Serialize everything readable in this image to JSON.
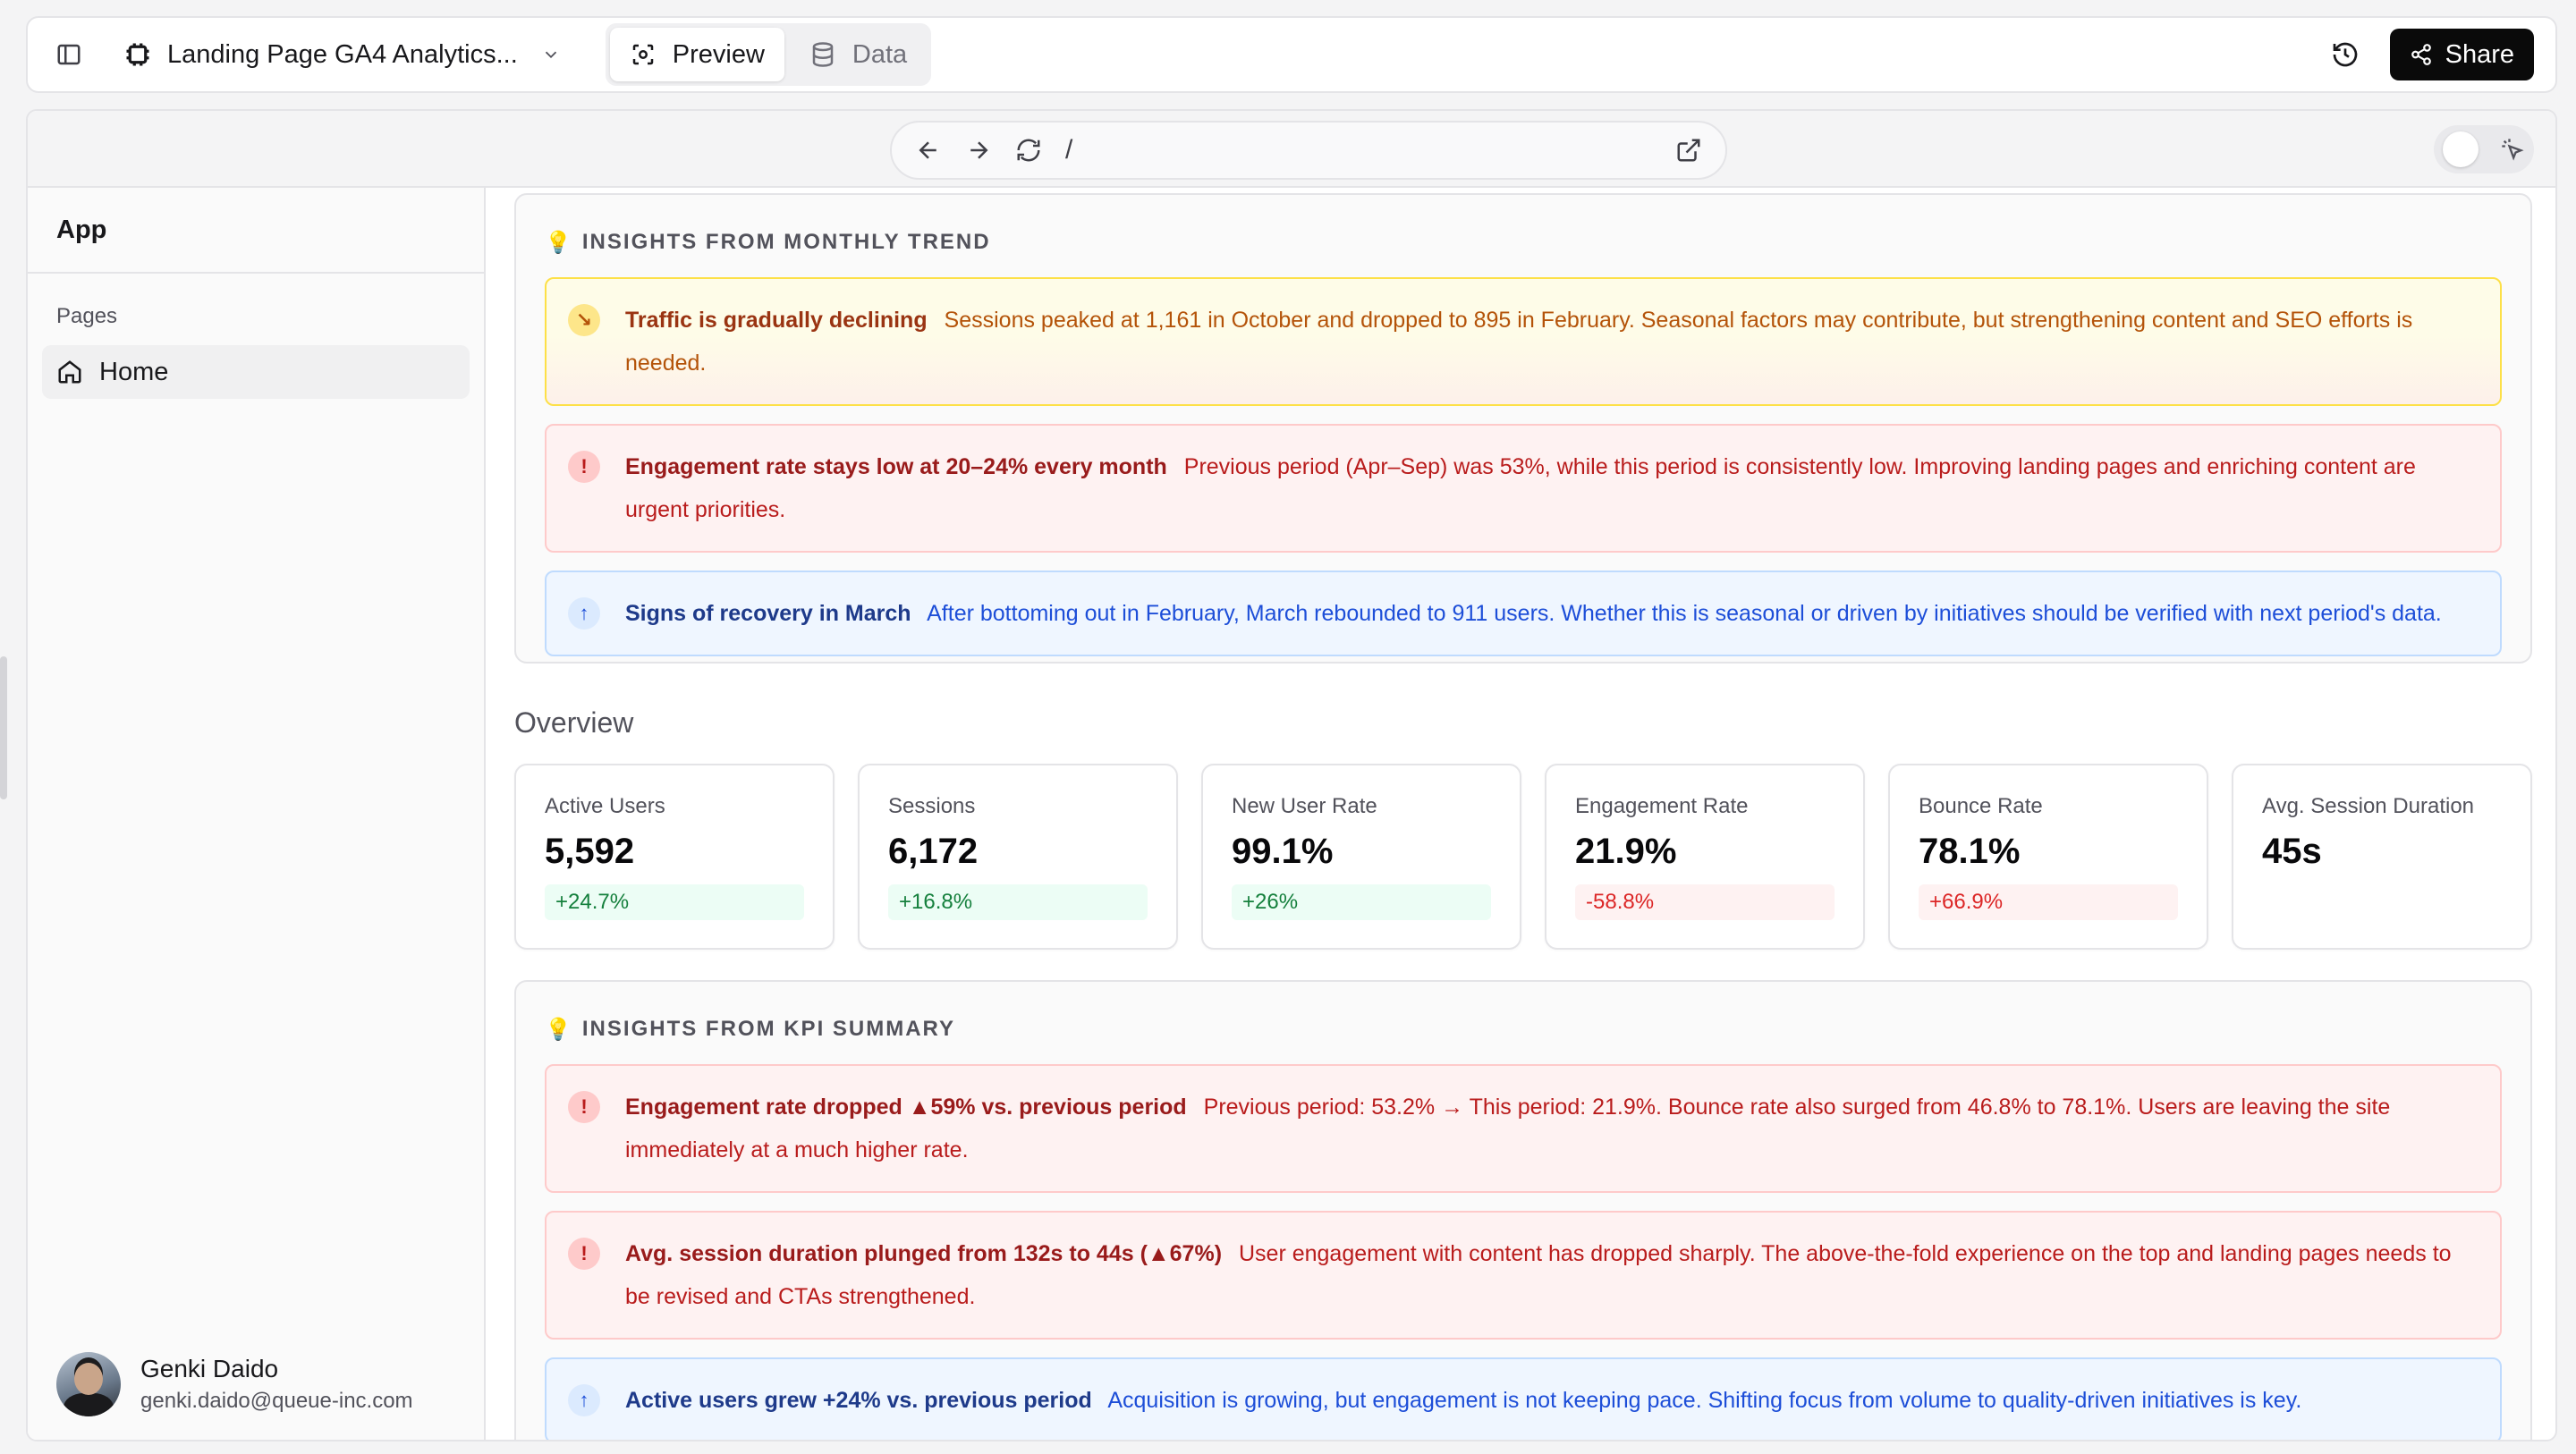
{
  "topbar": {
    "project_name": "Landing Page GA4 Analytics...",
    "tabs": [
      {
        "label": "Preview",
        "active": true
      },
      {
        "label": "Data",
        "active": false
      }
    ],
    "share_label": "Share"
  },
  "browser": {
    "path": "/"
  },
  "sidebar": {
    "app_title": "App",
    "section_label": "Pages",
    "items": [
      {
        "label": "Home",
        "icon": "home-icon",
        "active": true
      }
    ],
    "user": {
      "name": "Genki Daido",
      "email": "genki.daido@queue-inc.com"
    }
  },
  "insights_trend": {
    "header": "INSIGHTS FROM MONTHLY TREND",
    "items": [
      {
        "type": "warning",
        "icon": "arrow-down-right-icon",
        "title": "Traffic is gradually declining",
        "body": "Sessions peaked at 1,161 in October and dropped to 895 in February. Seasonal factors may contribute, but strengthening content and SEO efforts is needed."
      },
      {
        "type": "danger",
        "icon": "exclamation-icon",
        "title": "Engagement rate stays low at 20–24% every month",
        "body": "Previous period (Apr–Sep) was 53%, while this period is consistently low. Improving landing pages and enriching content are urgent priorities."
      },
      {
        "type": "info",
        "icon": "arrow-up-icon",
        "title": "Signs of recovery in March",
        "body": "After bottoming out in February, March rebounded to 911 users. Whether this is seasonal or driven by initiatives should be verified with next period's data."
      }
    ]
  },
  "overview": {
    "title": "Overview",
    "kpis": [
      {
        "label": "Active Users",
        "value": "5,592",
        "delta": "+24.7%",
        "trend": "up"
      },
      {
        "label": "Sessions",
        "value": "6,172",
        "delta": "+16.8%",
        "trend": "up"
      },
      {
        "label": "New User Rate",
        "value": "99.1%",
        "delta": "+26%",
        "trend": "up"
      },
      {
        "label": "Engagement Rate",
        "value": "21.9%",
        "delta": "-58.8%",
        "trend": "down"
      },
      {
        "label": "Bounce Rate",
        "value": "78.1%",
        "delta": "+66.9%",
        "trend": "down"
      },
      {
        "label": "Avg. Session Duration",
        "value": "45s",
        "delta": "",
        "trend": "none"
      }
    ]
  },
  "insights_kpi": {
    "header": "INSIGHTS FROM KPI SUMMARY",
    "items": [
      {
        "type": "danger",
        "icon": "exclamation-icon",
        "title": "Engagement rate dropped ▲59% vs. previous period",
        "body": "Previous period: 53.2% → This period: 21.9%. Bounce rate also surged from 46.8% to 78.1%. Users are leaving the site immediately at a much higher rate."
      },
      {
        "type": "danger",
        "icon": "exclamation-icon",
        "title": "Avg. session duration plunged from 132s to 44s (▲67%)",
        "body": "User engagement with content has dropped sharply. The above-the-fold experience on the top and landing pages needs to be revised and CTAs strengthened."
      },
      {
        "type": "info",
        "icon": "arrow-up-icon",
        "title": "Active users grew +24% vs. previous period",
        "body": "Acquisition is growing, but engagement is not keeping pace. Shifting focus from volume to quality-driven initiatives is key."
      }
    ]
  },
  "colors": {
    "warning": "#b45309",
    "danger": "#b91c1c",
    "info": "#1d4ed8",
    "positive": "#15803d",
    "negative": "#dc2626"
  }
}
